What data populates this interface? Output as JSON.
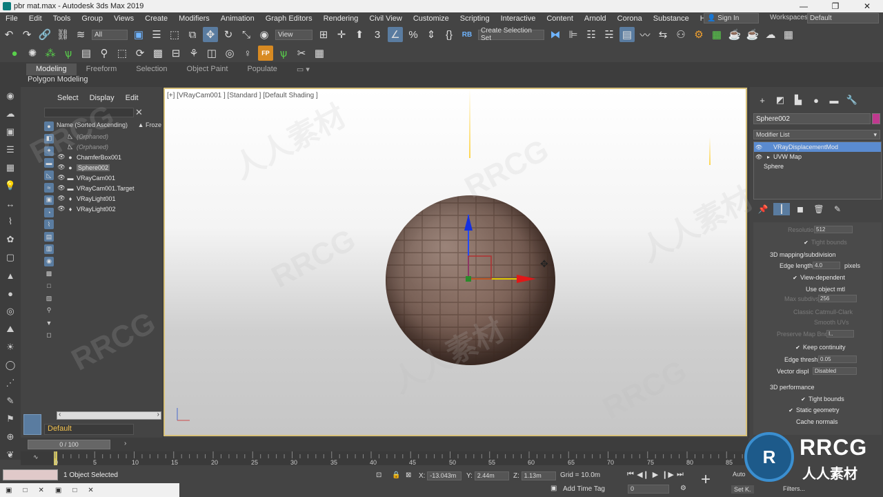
{
  "window": {
    "title": "pbr mat.max - Autodesk 3ds Max 2019",
    "controls": [
      "—",
      "❐",
      "✕"
    ]
  },
  "menu": {
    "items": [
      "File",
      "Edit",
      "Tools",
      "Group",
      "Views",
      "Create",
      "Modifiers",
      "Animation",
      "Graph Editors",
      "Rendering",
      "Civil View",
      "Customize",
      "Scripting",
      "Interactive",
      "Content",
      "Arnold",
      "Corona",
      "Substance",
      "Help"
    ],
    "signin": "Sign In",
    "workspaces_label": "Workspaces:",
    "workspaces_value": "Default"
  },
  "toolbar": {
    "filter_value": "All",
    "ref_coord": "View",
    "selection_set": "Create Selection Set",
    "rb_label": "RB",
    "fp_label": "FP"
  },
  "ribbon": {
    "tabs": [
      "Modeling",
      "Freeform",
      "Selection",
      "Object Paint",
      "Populate"
    ],
    "subtitle": "Polygon Modeling"
  },
  "explorer": {
    "menu": [
      "Select",
      "Display",
      "Edit"
    ],
    "column_name": "Name (Sorted Ascending)",
    "column_frozen": "▲ Froze",
    "rows": [
      {
        "label": "(Orphaned)",
        "dim": true
      },
      {
        "label": "(Orphaned)",
        "dim": true
      },
      {
        "label": "ChamferBox001",
        "dim": false
      },
      {
        "label": "Sphere002",
        "dim": false,
        "selected": true
      },
      {
        "label": "VRayCam001",
        "dim": false
      },
      {
        "label": "VRayCam001.Target",
        "dim": false
      },
      {
        "label": "VRayLight001",
        "dim": false
      },
      {
        "label": "VRayLight002",
        "dim": false
      }
    ],
    "layer": "Default"
  },
  "viewport": {
    "label": "[+] [VRayCam001 ] [Standard ] [Default Shading ]"
  },
  "command_panel": {
    "object_name": "Sphere002",
    "object_color": "#c0398f",
    "modifier_list": "Modifier List",
    "stack": [
      {
        "label": "VRayDisplacementMod",
        "active": true
      },
      {
        "label": "UVW Map",
        "active": false
      },
      {
        "label": "Sphere",
        "active": false
      }
    ],
    "params": {
      "resolution_label": "Resolution",
      "resolution_value": "512",
      "tight_bounds_top": "Tight bounds",
      "section_3d": "3D mapping/subdivision",
      "edge_length_label": "Edge length",
      "edge_length_value": "4.0",
      "edge_length_unit": "pixels",
      "view_dependent": "View-dependent",
      "use_object_mtl": "Use object mtl",
      "max_subdivs_label": "Max subdivs",
      "max_subdivs_value": "256",
      "classic_catmull": "Classic Catmull-Clark",
      "smooth_uvs": "Smooth UVs",
      "preserve_map_bnd_label": "Preserve Map Bnd",
      "preserve_map_bnd_value": "I..",
      "keep_continuity": "Keep continuity",
      "edge_thresh_label": "Edge thresh",
      "edge_thresh_value": "0.05",
      "vector_displ_label": "Vector displ",
      "vector_displ_value": "Disabled",
      "section_perf": "3D performance",
      "tight_bounds": "Tight bounds",
      "static_geometry": "Static geometry",
      "cache_normals": "Cache normals"
    }
  },
  "timeline": {
    "frame": "0 / 100",
    "ticks": [
      "0",
      "5",
      "10",
      "15",
      "20",
      "25",
      "30",
      "35",
      "40",
      "45",
      "50",
      "55",
      "60",
      "65",
      "70",
      "75",
      "80",
      "85"
    ]
  },
  "status": {
    "selected": "1 Object Selected",
    "x_label": "X:",
    "x_value": "-13.043m",
    "y_label": "Y:",
    "y_value": "2.44m",
    "z_label": "Z:",
    "z_value": "1.13m",
    "grid": "Grid = 10.0m",
    "add_time_tag": "Add Time Tag",
    "auto": "Auto",
    "set_k": "Set K.",
    "filters": "Filters...",
    "spinner_value": "0"
  },
  "logo": {
    "mark": "R",
    "brand": "RRCG",
    "cn": "人人素材"
  },
  "watermarks": [
    "RRCG",
    "人人素材",
    "RRCG",
    "人人素材",
    "RRCG",
    "RRCG",
    "人人素材",
    "RRCG"
  ]
}
